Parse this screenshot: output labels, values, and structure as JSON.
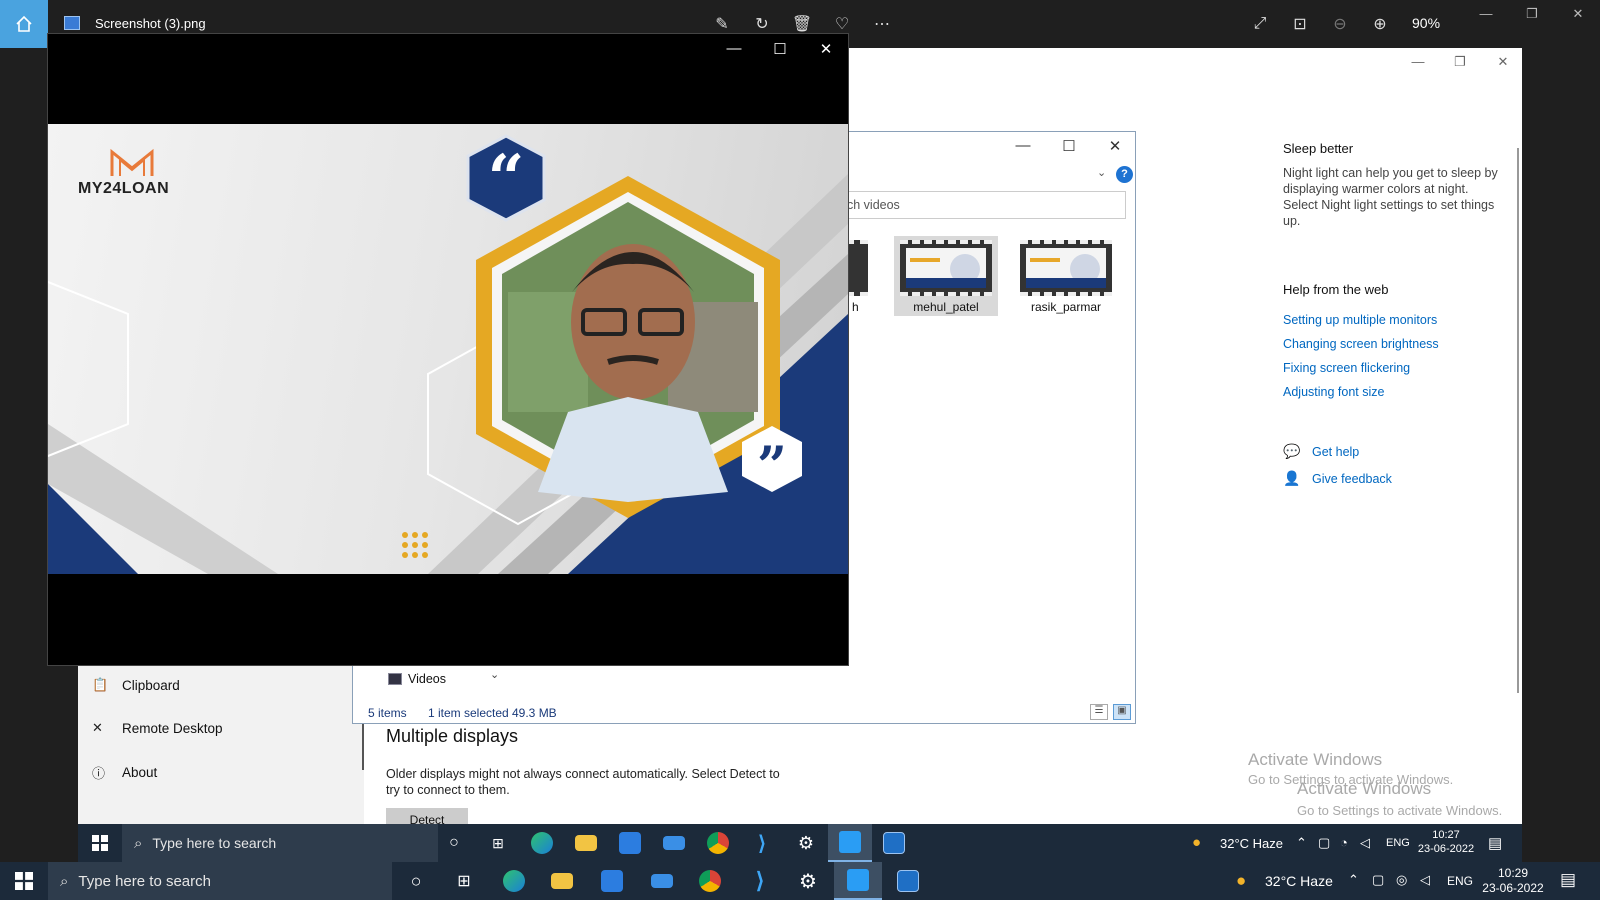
{
  "photos": {
    "title": "Screenshot (3).png",
    "zoom": "90%",
    "toolbar_icons": [
      "edit-icon",
      "rotate-icon",
      "delete-icon",
      "favorite-icon",
      "more-icon"
    ],
    "view_icons": [
      "fullscreen-icon",
      "actual-size-icon",
      "zoom-out-icon",
      "zoom-in-icon"
    ]
  },
  "settings": {
    "sleep_heading": "Sleep better",
    "sleep_text": "Night light can help you get to sleep by displaying warmer colors at night. Select Night light settings to set things up.",
    "help_heading": "Help from the web",
    "help_links": [
      "Setting up multiple monitors",
      "Changing screen brightness",
      "Fixing screen flickering",
      "Adjusting font size"
    ],
    "get_help": "Get help",
    "give_feedback": "Give feedback",
    "nav": {
      "clipboard": "Clipboard",
      "remote_desktop": "Remote Desktop",
      "about": "About"
    },
    "multiple_displays_title": "Multiple displays",
    "multiple_displays_text": "Older displays might not always connect automatically. Select Detect to try to connect to them.",
    "detect_button": "Detect"
  },
  "activation": {
    "title": "Activate Windows",
    "subtitle": "Go to Settings to activate Windows."
  },
  "explorer": {
    "search_placeholder": "ch videos",
    "partial_label": "h",
    "files": [
      {
        "name": "mehul_patel",
        "selected": true
      },
      {
        "name": "rasik_parmar",
        "selected": false
      }
    ],
    "tree_item": "Videos",
    "status_count": "5 items",
    "status_selected": "1 item selected",
    "status_size": "49.3 MB"
  },
  "viewer": {
    "logo_text": "MY24LOAN",
    "colors": {
      "navy": "#1b3a7a",
      "gold": "#e5a823",
      "logo_orange": "#e87a3a"
    }
  },
  "taskbar_inner": {
    "search_placeholder": "Type here to search",
    "weather": "32°C  Haze",
    "lang": "ENG",
    "time": "10:27",
    "date": "23-06-2022",
    "notifications": "1"
  },
  "taskbar_main": {
    "search_placeholder": "Type here to search",
    "weather": "32°C  Haze",
    "lang": "ENG",
    "time": "10:29",
    "date": "23-06-2022",
    "notifications": "1"
  },
  "taskbar_apps": [
    "task-view-icon",
    "edge-icon",
    "file-explorer-icon",
    "store-icon",
    "mail-icon",
    "chrome-icon",
    "vscode-icon",
    "settings-icon",
    "media-player-icon",
    "photos-icon"
  ]
}
